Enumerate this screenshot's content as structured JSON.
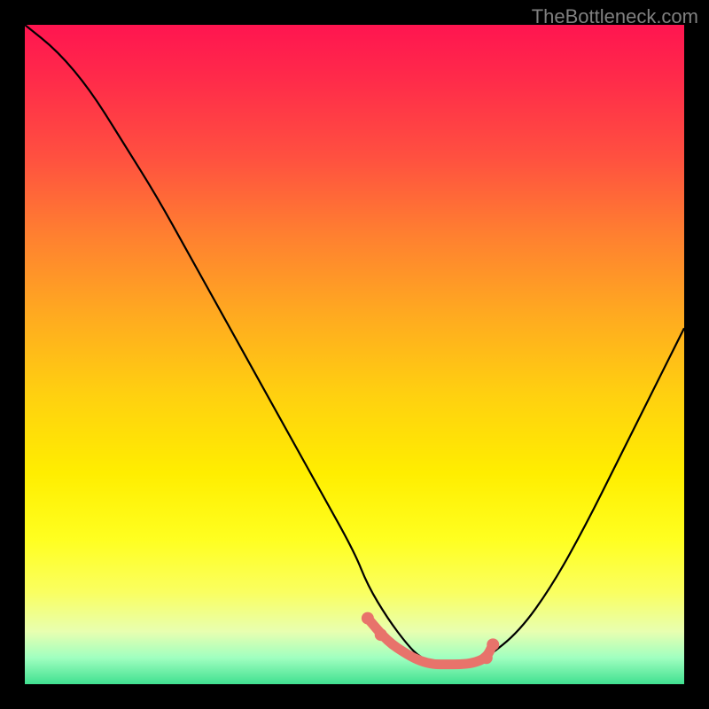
{
  "attribution": "TheBottleneck.com",
  "chart_data": {
    "type": "line",
    "title": "",
    "xlabel": "",
    "ylabel": "",
    "xlim": [
      0,
      100
    ],
    "ylim": [
      0,
      100
    ],
    "series": [
      {
        "name": "bottleneck-curve",
        "color": "#000000",
        "x": [
          0,
          5,
          10,
          15,
          20,
          25,
          30,
          35,
          40,
          45,
          50,
          52,
          55,
          58,
          60,
          63,
          65,
          68,
          70,
          75,
          80,
          85,
          90,
          95,
          100
        ],
        "values": [
          100,
          96,
          90,
          82,
          74,
          65,
          56,
          47,
          38,
          29,
          20,
          15,
          10,
          6,
          4,
          3,
          3,
          3,
          4,
          8,
          15,
          24,
          34,
          44,
          54
        ]
      }
    ],
    "highlight": {
      "name": "optimal-range",
      "color": "#e8736b",
      "x": [
        52,
        55,
        58,
        60,
        62,
        64,
        66,
        68,
        70,
        71
      ],
      "values": [
        10,
        6.5,
        4.5,
        3.5,
        3,
        3,
        3,
        3.2,
        4,
        6
      ],
      "dots_x": [
        52,
        54,
        70,
        71
      ],
      "dots_y": [
        10,
        7.5,
        4,
        6
      ]
    },
    "gradient_note": "Background heat gradient from red (high bottleneck) at top to green (optimal) at bottom"
  }
}
